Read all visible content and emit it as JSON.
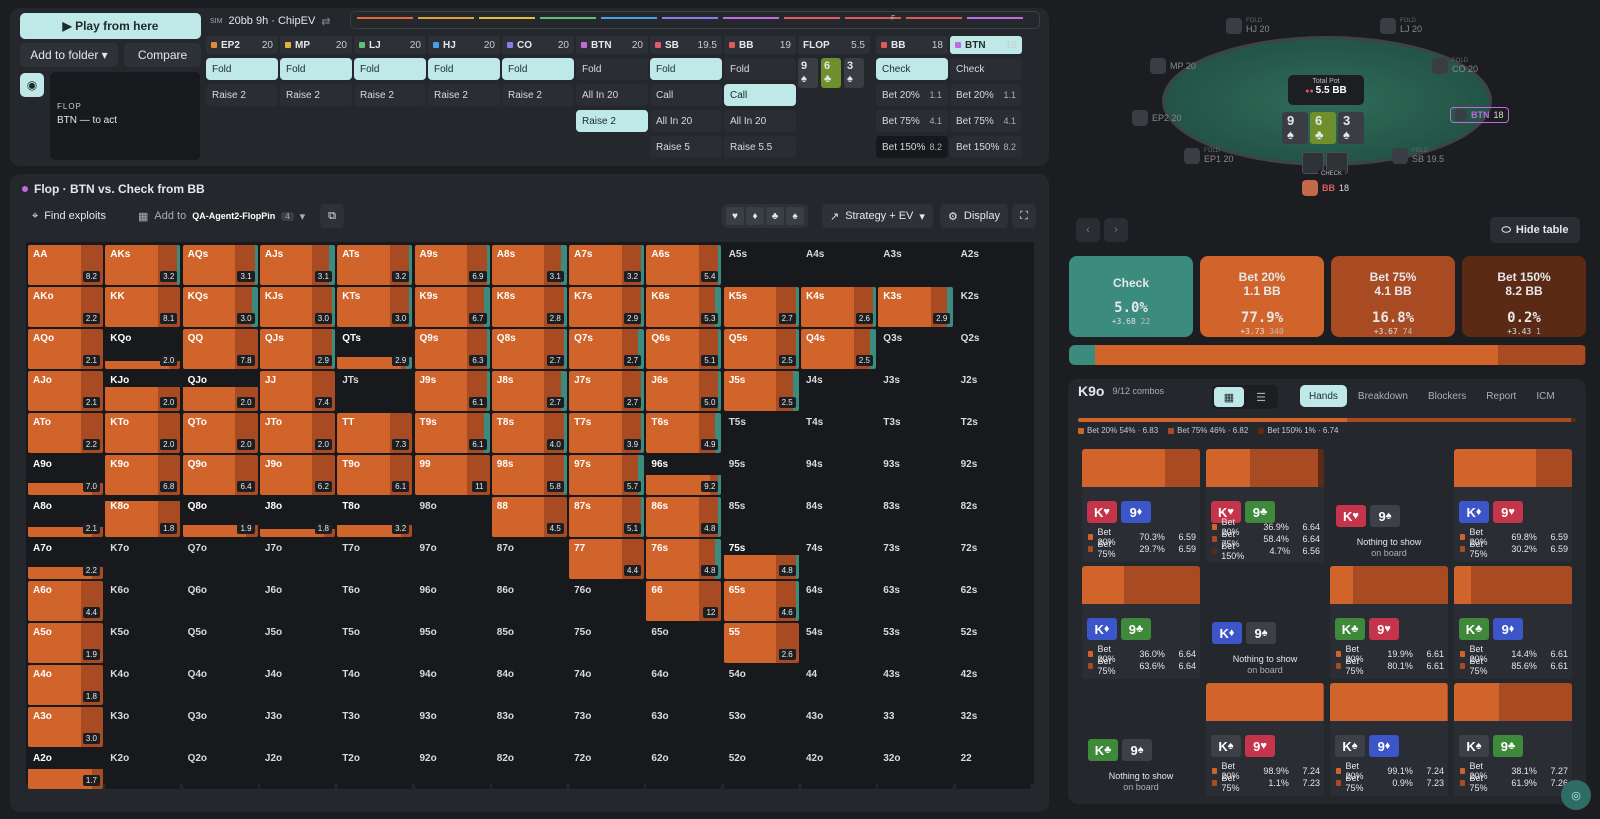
{
  "top": {
    "play_label": "▶ Play from here",
    "add_folder_label": "Add to folder ▾",
    "compare_label": "Compare",
    "street_label": "FLOP",
    "to_act_label": "BTN — to act",
    "sim_tag": "SIM",
    "sim_label": "20bb 9h · ChipEV",
    "columns": [
      {
        "pos": "EP2",
        "stack": "20",
        "color": "#e08a3a",
        "actions": [
          {
            "l": "Fold",
            "s": true
          },
          {
            "l": "Raise 2"
          }
        ]
      },
      {
        "pos": "MP",
        "stack": "20",
        "color": "#e0b43a",
        "actions": [
          {
            "l": "Fold",
            "s": true
          },
          {
            "l": "Raise 2"
          }
        ]
      },
      {
        "pos": "LJ",
        "stack": "20",
        "color": "#5ec07a",
        "actions": [
          {
            "l": "Fold",
            "s": true
          },
          {
            "l": "Raise 2"
          }
        ]
      },
      {
        "pos": "HJ",
        "stack": "20",
        "color": "#4aa0e8",
        "actions": [
          {
            "l": "Fold",
            "s": true
          },
          {
            "l": "Raise 2"
          }
        ]
      },
      {
        "pos": "CO",
        "stack": "20",
        "color": "#8c7ae8",
        "actions": [
          {
            "l": "Fold",
            "s": true
          },
          {
            "l": "Raise 2"
          }
        ]
      },
      {
        "pos": "BTN",
        "stack": "20",
        "color": "#c06ae0",
        "actions": [
          {
            "l": "Fold"
          },
          {
            "l": "All In 20"
          },
          {
            "l": "Raise 2",
            "s": true
          }
        ]
      },
      {
        "pos": "SB",
        "stack": "19.5",
        "color": "#e05a6a",
        "actions": [
          {
            "l": "Fold",
            "s": true
          },
          {
            "l": "Call"
          },
          {
            "l": "All In 20"
          },
          {
            "l": "Raise 5"
          }
        ]
      },
      {
        "pos": "BB",
        "stack": "19",
        "color": "#e05a5a",
        "actions": [
          {
            "l": "Fold"
          },
          {
            "l": "Call",
            "s": true
          },
          {
            "l": "All In 20"
          },
          {
            "l": "Raise 5.5"
          }
        ]
      },
      {
        "pos": "BB",
        "stack": "18",
        "color": "#e05a5a",
        "actions": [
          {
            "l": "Check",
            "s": true
          },
          {
            "l": "Bet 20%",
            "ev": "1.1"
          },
          {
            "l": "Bet 75%",
            "ev": "4.1"
          },
          {
            "l": "Bet 150%",
            "ev": "8.2",
            "b": true
          }
        ]
      },
      {
        "pos": "BTN",
        "stack": "18",
        "color": "#c06ae0",
        "actions": [
          {
            "l": "Check"
          },
          {
            "l": "Bet 20%",
            "ev": "1.1"
          },
          {
            "l": "Bet 75%",
            "ev": "4.1"
          },
          {
            "l": "Bet 150%",
            "ev": "8.2"
          }
        ]
      }
    ],
    "flop_header": {
      "label": "FLOP",
      "pot": "5.5"
    },
    "flop_cards": [
      {
        "r": "9",
        "s": "♠"
      },
      {
        "r": "6",
        "s": "♣",
        "g": true
      },
      {
        "r": "3",
        "s": "♠"
      }
    ],
    "strip_f": "F"
  },
  "mid": {
    "title": "Flop · BTN vs. Check from BB",
    "find_exploits": "Find exploits",
    "add_to": "Add to",
    "folder": "QA-Agent2-FlopPin",
    "folder_count": "4",
    "strategy": "Strategy + EV",
    "display": "Display",
    "suits": [
      "♥",
      "♦",
      "♣",
      "♠"
    ]
  },
  "grid": {
    "ranks": [
      "A",
      "K",
      "Q",
      "J",
      "T",
      "9",
      "8",
      "7",
      "6",
      "5",
      "4",
      "3",
      "2"
    ],
    "ev": [
      [
        "8.2",
        "3.2",
        "3.1",
        "3.1",
        "3.2",
        "6.9",
        "3.1",
        "3.2",
        "5.4",
        "",
        "",
        "",
        ""
      ],
      [
        "2.2",
        "8.1",
        "3.0",
        "3.0",
        "3.0",
        "6.7",
        "2.8",
        "2.9",
        "5.3",
        "2.7",
        "2.6",
        "2.9",
        ""
      ],
      [
        "2.1",
        "2.0",
        "7.8",
        "2.9",
        "2.9",
        "6.3",
        "2.7",
        "2.7",
        "5.1",
        "2.5",
        "2.5",
        "",
        ""
      ],
      [
        "2.1",
        "2.0",
        "2.0",
        "7.4",
        "",
        "6.1",
        "2.7",
        "2.7",
        "5.0",
        "2.5",
        "",
        "",
        ""
      ],
      [
        "2.2",
        "2.0",
        "2.0",
        "2.0",
        "7.3",
        "6.1",
        "4.0",
        "3.9",
        "4.9",
        "",
        "",
        "",
        ""
      ],
      [
        "7.0",
        "6.8",
        "6.4",
        "6.2",
        "6.1",
        "11",
        "5.8",
        "5.7",
        "9.2",
        "",
        "",
        "",
        ""
      ],
      [
        "2.1",
        "1.8",
        "1.9",
        "1.8",
        "3.2",
        "",
        "4.5",
        "5.1",
        "4.8",
        "",
        "",
        "",
        ""
      ],
      [
        "2.2",
        "",
        "",
        "",
        "",
        "",
        "",
        "4.4",
        "4.8",
        "4.8",
        "",
        "",
        ""
      ],
      [
        "4.4",
        "",
        "",
        "",
        "",
        "",
        "",
        "",
        "12",
        "4.6",
        "",
        "",
        ""
      ],
      [
        "1.9",
        "",
        "",
        "",
        "",
        "",
        "",
        "",
        "",
        "2.6",
        "",
        "",
        ""
      ],
      [
        "1.8",
        "",
        "",
        "",
        "",
        "",
        "",
        "",
        "",
        "",
        "",
        "",
        ""
      ],
      [
        "3.0",
        "",
        "",
        "",
        "",
        "",
        "",
        "",
        "",
        "",
        "",
        "",
        ""
      ],
      [
        "1.7",
        "",
        "",
        "",
        "",
        "",
        "",
        "",
        "",
        "",
        "",
        "",
        ""
      ]
    ],
    "freq": [
      [
        1,
        1,
        1,
        1,
        1,
        1,
        1,
        1,
        1,
        0,
        0,
        0,
        0
      ],
      [
        1,
        1,
        1,
        1,
        1,
        1,
        1,
        1,
        1,
        1,
        1,
        1,
        0
      ],
      [
        1,
        0.2,
        1,
        1,
        0.3,
        1,
        1,
        1,
        1,
        1,
        1,
        0,
        0
      ],
      [
        1,
        0.6,
        0.6,
        1,
        0,
        1,
        1,
        1,
        1,
        1,
        0,
        0,
        0
      ],
      [
        1,
        1,
        1,
        1,
        1,
        1,
        1,
        1,
        1,
        0,
        0,
        0,
        0
      ],
      [
        0.3,
        1,
        1,
        1,
        1,
        1,
        1,
        1,
        0.5,
        0,
        0,
        0,
        0
      ],
      [
        0.25,
        0.9,
        0.3,
        0.2,
        0.3,
        0,
        1,
        1,
        1,
        0,
        0,
        0,
        0
      ],
      [
        0.3,
        0,
        0,
        0,
        0,
        0,
        0,
        1,
        1,
        0.6,
        0,
        0,
        0
      ],
      [
        1,
        0,
        0,
        0,
        0,
        0,
        0,
        0,
        1,
        1,
        0,
        0,
        0
      ],
      [
        1,
        0,
        0,
        0,
        0,
        0,
        0,
        0,
        0,
        1,
        0,
        0,
        0
      ],
      [
        1,
        0,
        0,
        0,
        0,
        0,
        0,
        0,
        0,
        0,
        0,
        0,
        0
      ],
      [
        1,
        0,
        0,
        0,
        0,
        0,
        0,
        0,
        0,
        0,
        0,
        0,
        0
      ],
      [
        0.5,
        0,
        0,
        0,
        0,
        0,
        0,
        0,
        0,
        0,
        0,
        0,
        0
      ]
    ]
  },
  "table": {
    "pot_label": "Total Pot",
    "pot_value": "5.5 BB",
    "check_tag": "CHECK",
    "hero": {
      "pos": "BB",
      "stack": "18"
    },
    "btn": {
      "pos": "BTN",
      "stack": "18"
    },
    "hide_label": "Hide table",
    "seats": [
      {
        "l": "FOLD",
        "n": "HJ 20"
      },
      {
        "l": "FOLD",
        "n": "LJ 20"
      },
      {
        "l": "",
        "n": "MP 20"
      },
      {
        "l": "FOLD",
        "n": "CO 20"
      },
      {
        "l": "",
        "n": "EP2 20"
      },
      {
        "l": "FOLD",
        "n": "EP1 20"
      },
      {
        "l": "FOLD",
        "n": "SB 19.5"
      }
    ]
  },
  "actions": [
    {
      "name": "Check",
      "size": "",
      "pct": "5.0%",
      "ev": "+3.68",
      "combos": "22",
      "bg": "#3b8b7f"
    },
    {
      "name": "Bet 20%",
      "size": "1.1 BB",
      "pct": "77.9%",
      "ev": "+3.73",
      "combos": "340",
      "bg": "#d0642a"
    },
    {
      "name": "Bet 75%",
      "size": "4.1 BB",
      "pct": "16.8%",
      "ev": "+3.67",
      "combos": "74",
      "bg": "#a84a22"
    },
    {
      "name": "Bet 150%",
      "size": "8.2 BB",
      "pct": "0.2%",
      "ev": "+3.43",
      "combos": "1",
      "bg": "#5a2a14"
    }
  ],
  "hands": {
    "title": "K9o",
    "combos": "9/12 combos",
    "tabs": [
      "Hands",
      "Breakdown",
      "Blockers",
      "Report",
      "ICM"
    ],
    "legend": [
      "Bet 20% 54% · 6.83",
      "Bet 75% 46% · 6.82",
      "Bet 150% 1% · 6.74"
    ],
    "nothing": "Nothing to show",
    "on_board": "on board",
    "cards": [
      {
        "c": [
          {
            "r": "K",
            "s": "♥",
            "k": "red"
          },
          {
            "r": "9",
            "s": "♦",
            "k": "blue"
          }
        ],
        "rows": [
          {
            "a": "Bet 20%",
            "p": "70.3%",
            "e": "6.59"
          },
          {
            "a": "Bet 75%",
            "p": "29.7%",
            "e": "6.59"
          }
        ]
      },
      {
        "c": [
          {
            "r": "K",
            "s": "♥",
            "k": "red"
          },
          {
            "r": "9",
            "s": "♣",
            "k": "green"
          }
        ],
        "rows": [
          {
            "a": "Bet 20%",
            "p": "36.9%",
            "e": "6.64"
          },
          {
            "a": "Bet 75%",
            "p": "58.4%",
            "e": "6.64"
          },
          {
            "a": "Bet 150%",
            "p": "4.7%",
            "e": "6.56"
          }
        ]
      },
      {
        "c": [
          {
            "r": "K",
            "s": "♥",
            "k": "red"
          },
          {
            "r": "9",
            "s": "♠",
            "k": "grey"
          }
        ],
        "rows": []
      },
      {
        "c": [
          {
            "r": "K",
            "s": "♦",
            "k": "blue"
          },
          {
            "r": "9",
            "s": "♥",
            "k": "red"
          }
        ],
        "rows": [
          {
            "a": "Bet 20%",
            "p": "69.8%",
            "e": "6.59"
          },
          {
            "a": "Bet 75%",
            "p": "30.2%",
            "e": "6.59"
          }
        ]
      },
      {
        "c": [
          {
            "r": "K",
            "s": "♦",
            "k": "blue"
          },
          {
            "r": "9",
            "s": "♣",
            "k": "green"
          }
        ],
        "rows": [
          {
            "a": "Bet 20%",
            "p": "36.0%",
            "e": "6.64"
          },
          {
            "a": "Bet 75%",
            "p": "63.6%",
            "e": "6.64"
          }
        ]
      },
      {
        "c": [
          {
            "r": "K",
            "s": "♦",
            "k": "blue"
          },
          {
            "r": "9",
            "s": "♠",
            "k": "grey"
          }
        ],
        "rows": []
      },
      {
        "c": [
          {
            "r": "K",
            "s": "♣",
            "k": "green"
          },
          {
            "r": "9",
            "s": "♥",
            "k": "red"
          }
        ],
        "rows": [
          {
            "a": "Bet 20%",
            "p": "19.9%",
            "e": "6.61"
          },
          {
            "a": "Bet 75%",
            "p": "80.1%",
            "e": "6.61"
          }
        ]
      },
      {
        "c": [
          {
            "r": "K",
            "s": "♣",
            "k": "green"
          },
          {
            "r": "9",
            "s": "♦",
            "k": "blue"
          }
        ],
        "rows": [
          {
            "a": "Bet 20%",
            "p": "14.4%",
            "e": "6.61"
          },
          {
            "a": "Bet 75%",
            "p": "85.6%",
            "e": "6.61"
          }
        ]
      },
      {
        "c": [
          {
            "r": "K",
            "s": "♣",
            "k": "green"
          },
          {
            "r": "9",
            "s": "♠",
            "k": "grey"
          }
        ],
        "rows": []
      },
      {
        "c": [
          {
            "r": "K",
            "s": "♠",
            "k": "grey"
          },
          {
            "r": "9",
            "s": "♥",
            "k": "red"
          }
        ],
        "rows": [
          {
            "a": "Bet 20%",
            "p": "98.9%",
            "e": "7.24"
          },
          {
            "a": "Bet 75%",
            "p": "1.1%",
            "e": "7.23"
          }
        ]
      },
      {
        "c": [
          {
            "r": "K",
            "s": "♠",
            "k": "grey"
          },
          {
            "r": "9",
            "s": "♦",
            "k": "blue"
          }
        ],
        "rows": [
          {
            "a": "Bet 20%",
            "p": "99.1%",
            "e": "7.24"
          },
          {
            "a": "Bet 75%",
            "p": "0.9%",
            "e": "7.23"
          }
        ]
      },
      {
        "c": [
          {
            "r": "K",
            "s": "♠",
            "k": "grey"
          },
          {
            "r": "9",
            "s": "♣",
            "k": "green"
          }
        ],
        "rows": [
          {
            "a": "Bet 20%",
            "p": "38.1%",
            "e": "7.27"
          },
          {
            "a": "Bet 75%",
            "p": "61.9%",
            "e": "7.26"
          }
        ]
      }
    ]
  },
  "colors": {
    "bet20": "#d0642a",
    "bet75": "#a84a22",
    "bet150": "#5a2a14",
    "check": "#3b8b7f",
    "accent": "#bfe9e8"
  }
}
